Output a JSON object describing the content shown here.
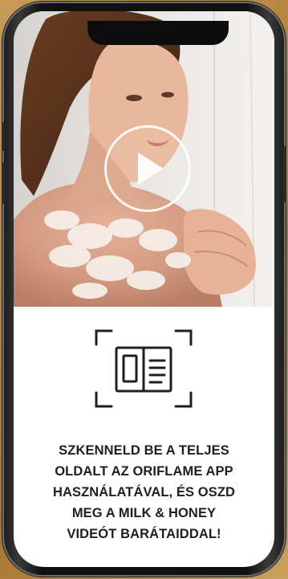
{
  "colors": {
    "background_gold": "#b8863f",
    "phone_frame": "#1a1a1a",
    "screen_bg": "#ffffff",
    "caption_text": "#1f1f1f"
  },
  "media": {
    "overlay_icon": "play-icon"
  },
  "scan_prompt": {
    "icon": "scan-book-icon",
    "lines": [
      "SZKENNELD BE A TELJES",
      "OLDALT AZ ORIFLAME APP",
      "HASZNÁLATÁVAL, ÉS OSZD",
      "MEG A MILK & HONEY",
      "VIDEÓT BARÁTAIDDAL!"
    ]
  }
}
